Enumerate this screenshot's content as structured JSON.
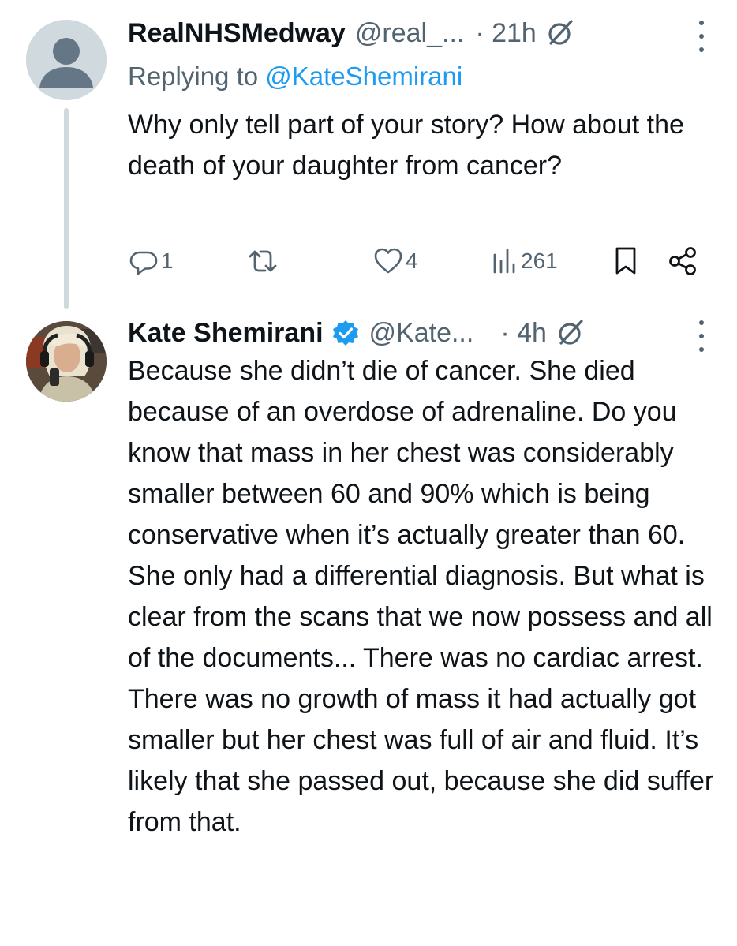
{
  "tweets": [
    {
      "author_name": "RealNHSMedway",
      "handle": "@real_...",
      "time": "· 21h",
      "replying_label": "Replying to ",
      "replying_to": "@KateShemirani",
      "body": "Why only tell part of your story? How about the death of your daughter from cancer?",
      "actions": {
        "replies": "1",
        "retweets": "",
        "likes": "4",
        "views": "261"
      },
      "icons": [
        "reply-icon",
        "retweet-icon",
        "like-icon",
        "views-icon",
        "bookmark-icon",
        "share-icon",
        "grok-icon",
        "more-icon"
      ]
    },
    {
      "author_name": "Kate Shemirani",
      "verified": true,
      "handle": "@Kate...",
      "time": "· 4h",
      "body": "Because she didn’t die of cancer. She died because of an overdose of adrenaline. Do you know that mass in her chest was considerably smaller between 60 and 90% which is being conservative when it’s actually greater than 60. She only had a differential diagnosis. But what is clear from the scans that we now possess and all of the documents... There was no cardiac arrest. There was no growth of mass it had actually got smaller but her chest was full of air and fluid. It’s likely that she passed out, because she did suffer from that.",
      "icons": [
        "verified-badge-icon",
        "grok-icon",
        "more-icon"
      ]
    }
  ],
  "colors": {
    "text": "#0f1419",
    "secondary": "#536471",
    "link": "#1d9bf0",
    "thread_line": "#cfd9de"
  }
}
